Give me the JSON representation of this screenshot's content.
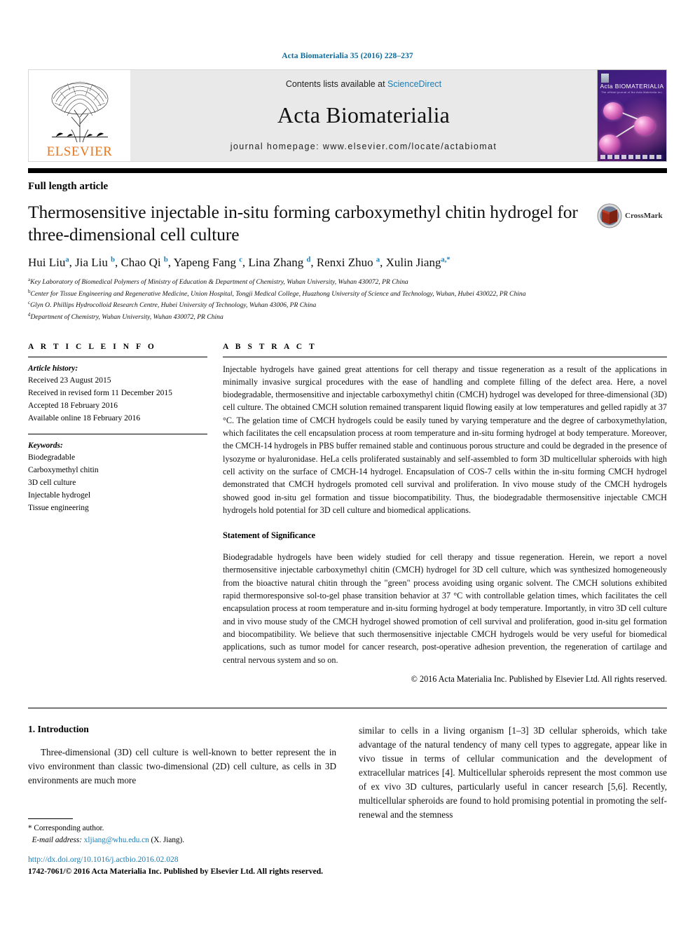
{
  "running_head": "Acta Biomaterialia 35 (2016) 228–237",
  "masthead": {
    "publisher_name": "ELSEVIER",
    "contents_prefix": "Contents lists available at ",
    "contents_link": "ScienceDirect",
    "journal_title": "Acta Biomaterialia",
    "homepage": "journal homepage: www.elsevier.com/locate/actabiomat",
    "cover_title": "Acta BIOMATERIALIA",
    "cover_subtitle": "The official journal of the Acta Materialia Inc."
  },
  "article_type": "Full length article",
  "title": "Thermosensitive injectable in-situ forming carboxymethyl chitin hydrogel for three-dimensional cell culture",
  "crossmark_label": "CrossMark",
  "authors": [
    {
      "name": "Hui Liu",
      "marks": "a"
    },
    {
      "name": "Jia Liu",
      "marks": "b"
    },
    {
      "name": "Chao Qi",
      "marks": "b"
    },
    {
      "name": "Yapeng Fang",
      "marks": "c"
    },
    {
      "name": "Lina Zhang",
      "marks": "d"
    },
    {
      "name": "Renxi Zhuo",
      "marks": "a"
    },
    {
      "name": "Xulin Jiang",
      "marks": "a,*"
    }
  ],
  "affiliations": [
    {
      "mark": "a",
      "text": "Key Laboratory of Biomedical Polymers of Ministry of Education & Department of Chemistry, Wuhan University, Wuhan 430072, PR China"
    },
    {
      "mark": "b",
      "text": "Center for Tissue Engineering and Regenerative Medicine, Union Hospital, Tongji Medical College, Huazhong University of Science and Technology, Wuhan, Hubei 430022, PR China"
    },
    {
      "mark": "c",
      "text": "Glyn O. Phillips Hydrocolloid Research Centre, Hubei University of Technology, Wuhan 43006, PR China"
    },
    {
      "mark": "d",
      "text": "Department of Chemistry, Wuhan University, Wuhan 430072, PR China"
    }
  ],
  "article_info": {
    "heading": "A R T I C L E   I N F O",
    "history_label": "Article history:",
    "history": [
      "Received 23 August 2015",
      "Received in revised form 11 December 2015",
      "Accepted 18 February 2016",
      "Available online 18 February 2016"
    ],
    "keywords_label": "Keywords:",
    "keywords": [
      "Biodegradable",
      "Carboxymethyl chitin",
      "3D cell culture",
      "Injectable hydrogel",
      "Tissue engineering"
    ]
  },
  "abstract": {
    "heading": "A B S T R A C T",
    "body": "Injectable hydrogels have gained great attentions for cell therapy and tissue regeneration as a result of the applications in minimally invasive surgical procedures with the ease of handling and complete filling of the defect area. Here, a novel biodegradable, thermosensitive and injectable carboxymethyl chitin (CMCH) hydrogel was developed for three-dimensional (3D) cell culture. The obtained CMCH solution remained transparent liquid flowing easily at low temperatures and gelled rapidly at 37 °C. The gelation time of CMCH hydrogels could be easily tuned by varying temperature and the degree of carboxymethylation, which facilitates the cell encapsulation process at room temperature and in-situ forming hydrogel at body temperature. Moreover, the CMCH-14 hydrogels in PBS buffer remained stable and continuous porous structure and could be degraded in the presence of lysozyme or hyaluronidase. HeLa cells proliferated sustainably and self-assembled to form 3D multicellular spheroids with high cell activity on the surface of CMCH-14 hydrogel. Encapsulation of COS-7 cells within the in-situ forming CMCH hydrogel demonstrated that CMCH hydrogels promoted cell survival and proliferation. In vivo mouse study of the CMCH hydrogels showed good in-situ gel formation and tissue biocompatibility. Thus, the biodegradable thermosensitive injectable CMCH hydrogels hold potential for 3D cell culture and biomedical applications.",
    "significance_heading": "Statement of Significance",
    "significance_body": "Biodegradable hydrogels have been widely studied for cell therapy and tissue regeneration. Herein, we report a novel thermosensitive injectable carboxymethyl chitin (CMCH) hydrogel for 3D cell culture, which was synthesized homogeneously from the bioactive natural chitin through the \"green\" process avoiding using organic solvent. The CMCH solutions exhibited rapid thermoresponsive sol-to-gel phase transition behavior at 37 °C with controllable gelation times, which facilitates the cell encapsulation process at room temperature and in-situ forming hydrogel at body temperature. Importantly, in vitro 3D cell culture and in vivo mouse study of the CMCH hydrogel showed promotion of cell survival and proliferation, good in-situ gel formation and biocompatibility. We believe that such thermosensitive injectable CMCH hydrogels would be very useful for biomedical applications, such as tumor model for cancer research, post-operative adhesion prevention, the regeneration of cartilage and central nervous system and so on.",
    "copyright": "© 2016 Acta Materialia Inc. Published by Elsevier Ltd. All rights reserved."
  },
  "introduction": {
    "heading": "1. Introduction",
    "col_left": "Three-dimensional (3D) cell culture is well-known to better represent the in vivo environment than classic two-dimensional (2D) cell culture, as cells in 3D environments are much more",
    "col_right": "similar to cells in a living organism [1–3] 3D cellular spheroids, which take advantage of the natural tendency of many cell types to aggregate, appear like in vivo tissue in terms of cellular communication and the development of extracellular matrices [4]. Multicellular spheroids represent the most common use of ex vivo 3D cultures, particularly useful in cancer research [5,6]. Recently, multicellular spheroids are found to hold promising potential in promoting the self-renewal and the stemness"
  },
  "footnote": {
    "corresponding": "* Corresponding author.",
    "email_label": "E-mail address:",
    "email": "xljiang@whu.edu.cn",
    "email_suffix": "(X. Jiang)."
  },
  "footer": {
    "doi": "http://dx.doi.org/10.1016/j.actbio.2016.02.028",
    "issn": "1742-7061/© 2016 Acta Materialia Inc. Published by Elsevier Ltd. All rights reserved."
  }
}
